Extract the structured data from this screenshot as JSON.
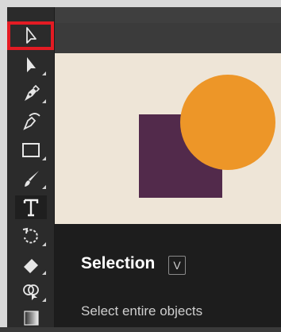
{
  "tooltip": {
    "title": "Selection",
    "shortcut_key": "V",
    "description": "Select entire objects"
  },
  "tools": [
    {
      "name": "selection-tool",
      "icon": "selection-arrow-icon",
      "active": true
    },
    {
      "name": "direct-selection-tool",
      "icon": "direct-selection-arrow-icon"
    },
    {
      "name": "pen-tool",
      "icon": "pen-icon"
    },
    {
      "name": "curvature-tool",
      "icon": "curvature-pen-icon"
    },
    {
      "name": "rectangle-tool",
      "icon": "rectangle-icon"
    },
    {
      "name": "paintbrush-tool",
      "icon": "paintbrush-icon"
    },
    {
      "name": "type-tool",
      "icon": "type-icon"
    },
    {
      "name": "rotate-tool",
      "icon": "rotate-icon"
    },
    {
      "name": "eraser-tool",
      "icon": "eraser-icon"
    },
    {
      "name": "shape-builder-tool",
      "icon": "shape-builder-icon"
    },
    {
      "name": "gradient-tool",
      "icon": "gradient-icon"
    }
  ],
  "artwork": {
    "square_color": "#522a4b",
    "circle_color": "#ed9628",
    "canvas_color": "#eee5d7"
  },
  "colors": {
    "highlight": "#e31b23",
    "toolbar_bg": "#2b2b2b",
    "panel_bg": "#1d1d1d"
  }
}
